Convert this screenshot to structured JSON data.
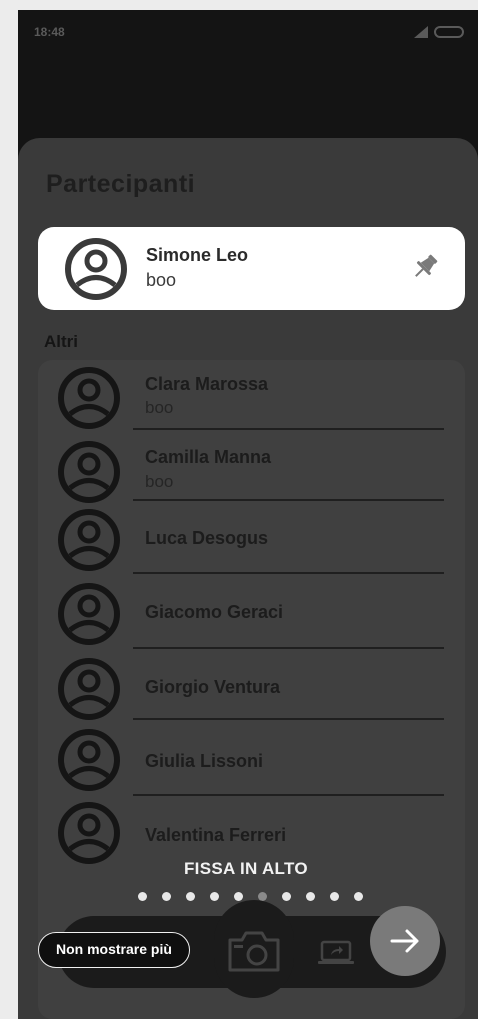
{
  "status_bar": {
    "time": "18:48"
  },
  "sheet": {
    "title": "Partecipanti",
    "pinned_participant": {
      "name": "Simone Leo",
      "status": "boo"
    },
    "section_label": "Altri",
    "others": [
      {
        "name": "Clara Marossa",
        "status": "boo"
      },
      {
        "name": "Camilla Manna",
        "status": "boo"
      },
      {
        "name": "Luca Desogus",
        "status": ""
      },
      {
        "name": "Giacomo Geraci",
        "status": ""
      },
      {
        "name": "Giorgio Ventura",
        "status": ""
      },
      {
        "name": "Giulia Lissoni",
        "status": ""
      },
      {
        "name": "Valentina Ferreri",
        "status": ""
      }
    ]
  },
  "tutorial": {
    "label": "FISSA IN ALTO",
    "page_count": 10,
    "current_page": 6,
    "skip_label": "Non mostrare più"
  },
  "icons": {
    "avatar": "user-circle-icon",
    "pin": "pin-icon",
    "camera": "camera-icon",
    "screen_share": "screen-share-icon",
    "next": "arrow-right-icon"
  }
}
